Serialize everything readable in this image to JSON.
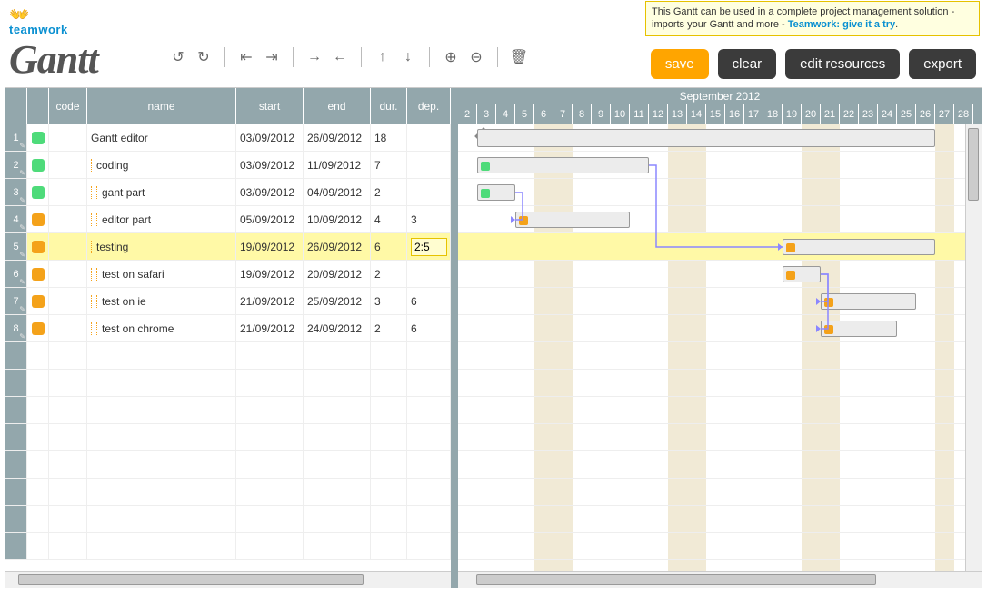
{
  "banner": {
    "text": "This Gantt can be used in a complete project management solution - imports your Gantt and more - ",
    "link_text": "Teamwork: give it a try",
    "link_suffix": "."
  },
  "logo": {
    "brand": "teamwork",
    "title": "Gantt"
  },
  "toolbar": {
    "undo": "↺",
    "redo": "↻",
    "indent": "⇤",
    "outdent": "⇥",
    "moveRight": "→",
    "moveLeft": "←",
    "moveUp": "↑",
    "moveDown": "↓",
    "zoomIn": "⊕",
    "zoomOut": "⊖",
    "delete": "🗑"
  },
  "buttons": {
    "save": "save",
    "clear": "clear",
    "edit_resources": "edit resources",
    "export": "export"
  },
  "columns": {
    "code": "code",
    "name": "name",
    "start": "start",
    "end": "end",
    "dur": "dur.",
    "dep": "dep."
  },
  "month_label": "September 2012",
  "days": [
    2,
    3,
    4,
    5,
    6,
    7,
    8,
    9,
    10,
    11,
    12,
    13,
    14,
    15,
    16,
    17,
    18,
    19,
    20,
    21,
    22,
    23,
    24,
    25,
    26,
    27,
    28
  ],
  "weekend_cols": [
    6,
    7,
    13,
    14,
    20,
    21,
    27
  ],
  "selected_row": 5,
  "dep_input_value": "2:5",
  "tasks": [
    {
      "n": 1,
      "status": "green",
      "indent": 0,
      "name": "Gantt editor",
      "start": "03/09/2012",
      "end": "26/09/2012",
      "dur": "18",
      "dep": "",
      "bar_start": 1,
      "bar_len": 24,
      "milestone": true
    },
    {
      "n": 2,
      "status": "green",
      "indent": 1,
      "name": "coding",
      "start": "03/09/2012",
      "end": "11/09/2012",
      "dur": "7",
      "dep": "",
      "bar_start": 1,
      "bar_len": 9,
      "dot": "green"
    },
    {
      "n": 3,
      "status": "green",
      "indent": 2,
      "name": "gant part",
      "start": "03/09/2012",
      "end": "04/09/2012",
      "dur": "2",
      "dep": "",
      "bar_start": 1,
      "bar_len": 2,
      "dot": "green"
    },
    {
      "n": 4,
      "status": "orange",
      "indent": 2,
      "name": "editor part",
      "start": "05/09/2012",
      "end": "10/09/2012",
      "dur": "4",
      "dep": "3",
      "bar_start": 3,
      "bar_len": 6,
      "dot": "orange"
    },
    {
      "n": 5,
      "status": "orange",
      "indent": 1,
      "name": "testing",
      "start": "19/09/2012",
      "end": "26/09/2012",
      "dur": "6",
      "dep": "2:5",
      "bar_start": 17,
      "bar_len": 8,
      "dot": "orange"
    },
    {
      "n": 6,
      "status": "orange",
      "indent": 2,
      "name": "test on safari",
      "start": "19/09/2012",
      "end": "20/09/2012",
      "dur": "2",
      "dep": "",
      "bar_start": 17,
      "bar_len": 2,
      "dot": "orange"
    },
    {
      "n": 7,
      "status": "orange",
      "indent": 2,
      "name": "test on ie",
      "start": "21/09/2012",
      "end": "25/09/2012",
      "dur": "3",
      "dep": "6",
      "bar_start": 19,
      "bar_len": 5,
      "dot": "orange"
    },
    {
      "n": 8,
      "status": "orange",
      "indent": 2,
      "name": "test on chrome",
      "start": "21/09/2012",
      "end": "24/09/2012",
      "dur": "2",
      "dep": "6",
      "bar_start": 19,
      "bar_len": 4,
      "dot": "orange"
    }
  ]
}
